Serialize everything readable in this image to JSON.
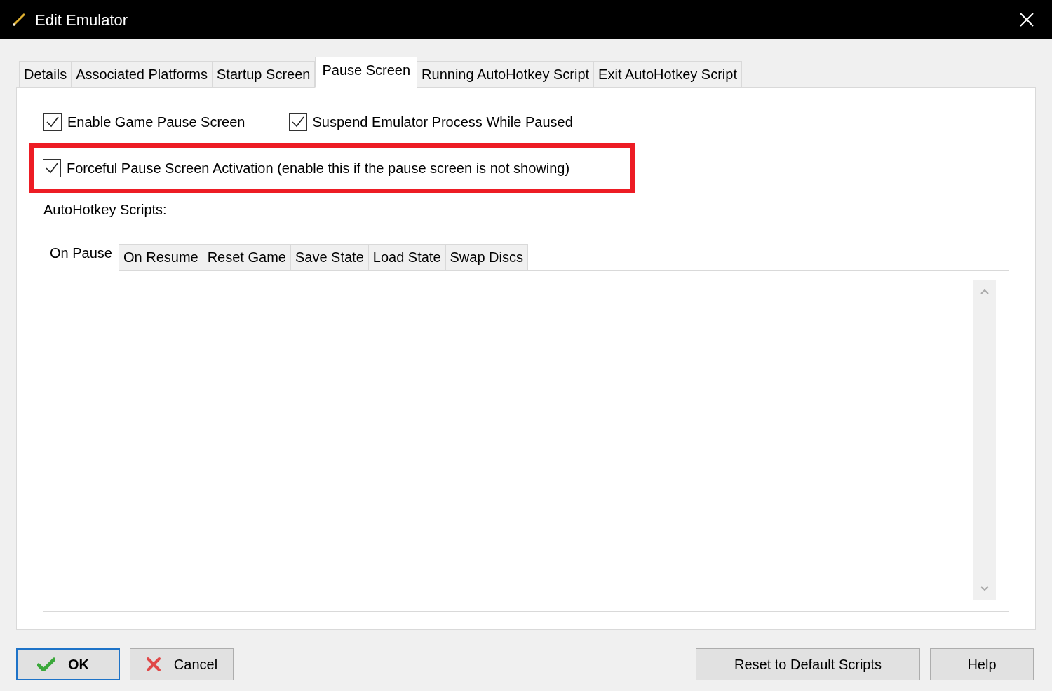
{
  "window": {
    "title": "Edit Emulator"
  },
  "tabs": [
    {
      "label": "Details",
      "selected": false
    },
    {
      "label": "Associated Platforms",
      "selected": false
    },
    {
      "label": "Startup Screen",
      "selected": false
    },
    {
      "label": "Pause Screen",
      "selected": true
    },
    {
      "label": "Running AutoHotkey Script",
      "selected": false
    },
    {
      "label": "Exit AutoHotkey Script",
      "selected": false
    }
  ],
  "options": [
    {
      "label": "Enable Game Pause Screen",
      "checked": true,
      "highlighted": false
    },
    {
      "label": "Suspend Emulator Process While Paused",
      "checked": true,
      "highlighted": false
    },
    {
      "label": "Forceful Pause Screen Activation (enable this if the pause screen is not showing)",
      "checked": true,
      "highlighted": true
    }
  ],
  "scripts_label": "AutoHotkey Scripts:",
  "script_tabs": [
    {
      "label": "On Pause",
      "selected": true
    },
    {
      "label": "On Resume",
      "selected": false
    },
    {
      "label": "Reset Game",
      "selected": false
    },
    {
      "label": "Save State",
      "selected": false
    },
    {
      "label": "Load State",
      "selected": false
    },
    {
      "label": "Swap Discs",
      "selected": false
    }
  ],
  "buttons": [
    {
      "kind": "ok",
      "label": "OK"
    },
    {
      "kind": "cancel",
      "label": "Cancel"
    },
    {
      "kind": "plain",
      "label": "Reset to Default Scripts"
    },
    {
      "kind": "plain",
      "label": "Help"
    }
  ]
}
